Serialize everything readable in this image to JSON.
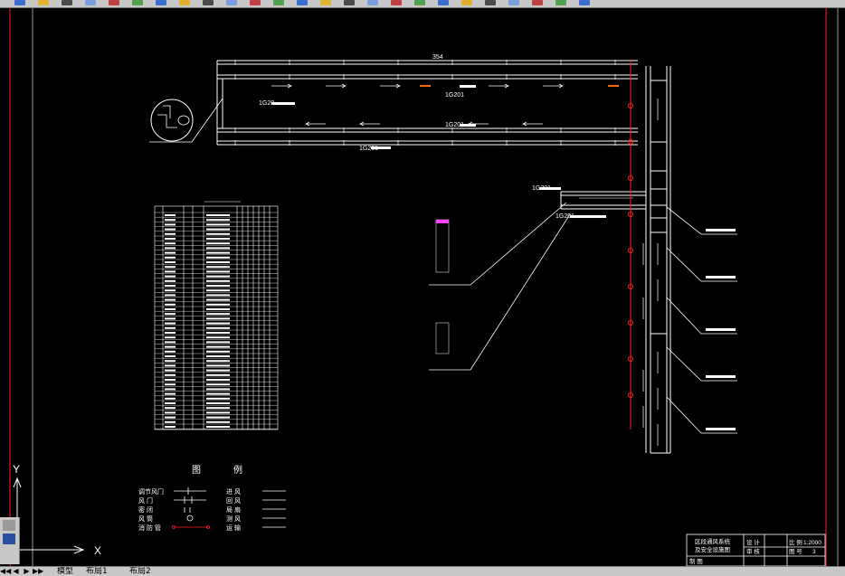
{
  "colors": {
    "background": "#000000",
    "line": "#ffffff",
    "red": "#ff2020",
    "orange": "#ff6a00",
    "magenta": "#ff40ff",
    "toolbar": "#c8c8c8"
  },
  "toolbar": {
    "icons": [
      "qnew-icon",
      "open-icon",
      "save-icon",
      "plot-icon",
      "preview-icon",
      "publish-icon",
      "cut-icon",
      "copy-icon",
      "paste-icon",
      "match-properties-icon",
      "undo-icon",
      "redo-icon",
      "pan-icon",
      "zoom-realtime-icon",
      "zoom-window-icon",
      "zoom-previous-icon",
      "properties-icon",
      "design-center-icon",
      "tool-palettes-icon",
      "sheet-set-icon",
      "markup-icon",
      "quickcalc-icon",
      "layer-icon",
      "layer-prev-icon",
      "layer-state-icon"
    ]
  },
  "drawing": {
    "top_dimension": "354",
    "labels": {
      "upper_airway_a": "1G201",
      "upper_airway_b": "1G201",
      "lower_airway": "1G201",
      "upper_airway_left": "1G20",
      "right_branch_top": "1G201",
      "right_branch_mid": "1G201"
    },
    "ucs": {
      "y_label": "Y",
      "x_label": "X"
    }
  },
  "legend": {
    "title_left": "图",
    "title_right": "例",
    "left": [
      "调节风门",
      "风    门",
      "密    闭",
      "风    筒",
      "消 防 管"
    ],
    "right": [
      "进    风",
      "回    风",
      "局    扇",
      "测    风",
      "运    输"
    ]
  },
  "title_block": {
    "title_line1": "区段通风系统",
    "title_line2": "及安全设施图",
    "labels": {
      "scale": "比 例",
      "scale_value": "1:2000",
      "sheet": "图 号",
      "sheet_value": "3",
      "design": "设 计",
      "check": "审 核",
      "draw": "制 图"
    }
  },
  "tabs": {
    "nav": [
      "◀◀",
      "◀",
      "▶",
      "▶▶"
    ],
    "items": [
      "模型",
      "布局1",
      "布局2"
    ]
  }
}
